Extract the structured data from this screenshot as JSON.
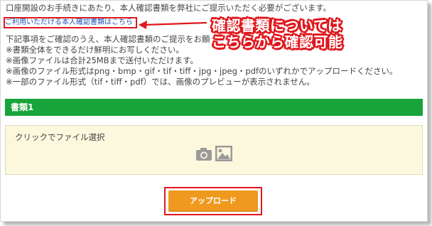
{
  "intro_text": "口座開設のお手続きにあたり、本人確認書類を弊社にご提示いただく必要がございます。",
  "link_text": "ご利用いただける本人確認書類はこちら",
  "callout": {
    "line1": "確認書類については",
    "line2": "こちらから確認可能"
  },
  "instructions": [
    "下記事項をご確認のうえ、本人確認書類のご提示をお願",
    "※書類全体をできるだけ鮮明にお写しください。",
    "※画像ファイルは合計25MBまで送付いただけます。",
    "※画像のファイル形式はpng・bmp・gif・tif・tiff・jpg・jpeg・pdfのいずれかでアップロードください。",
    "※一部のファイル形式（tif・tiff・pdf）では、画像のプレビューが表示されません。"
  ],
  "section_title": "書類1",
  "dropzone_label": "クリックでファイル選択",
  "upload_button": "アップロード",
  "icons": [
    "camera-icon",
    "image-icon"
  ],
  "colors": {
    "accent_green": "#19a33b",
    "annotation_red": "#e0171d",
    "button_orange": "#ef9a1f",
    "link_blue": "#1b56b3",
    "dropzone_bg": "#fbf8dd"
  }
}
